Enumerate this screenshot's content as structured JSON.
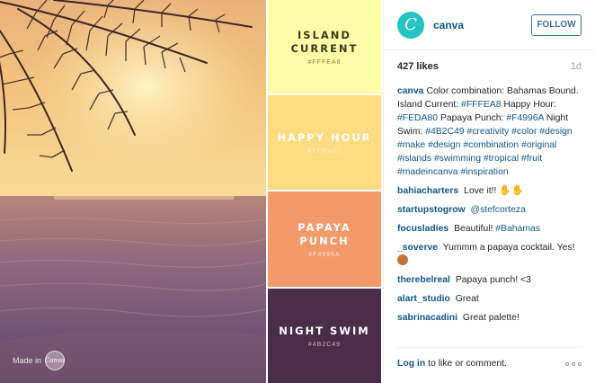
{
  "colors": {
    "island_current": "#FFFEA8",
    "happy_hour": "#FEDA80",
    "papaya_punch": "#F4996A",
    "night_swim": "#4B2C49",
    "link": "#125688",
    "follow_border": "#3f729b",
    "brand": "#23c4c1"
  },
  "photo": {
    "watermark_text": "Made in",
    "watermark_logo": "Canva"
  },
  "swatches": [
    {
      "name": "ISLAND CURRENT",
      "hex": "#FFFEA8"
    },
    {
      "name": "HAPPY HOUR",
      "hex": "#FEDA80"
    },
    {
      "name": "PAPAYA PUNCH",
      "hex": "#F4996A"
    },
    {
      "name": "NIGHT SWIM",
      "hex": "#4B2C49"
    }
  ],
  "header": {
    "avatar_letter": "C",
    "username": "canva",
    "follow_label": "FOLLOW"
  },
  "stats": {
    "likes": "427 likes",
    "time": "1d"
  },
  "caption": {
    "user": "canva",
    "segments": [
      {
        "text": "Color combination: Bahamas Bound. Island Current: ",
        "link": false
      },
      {
        "text": "#FFFEA8",
        "link": true
      },
      {
        "text": " Happy Hour: ",
        "link": false
      },
      {
        "text": "#FEDA80",
        "link": true
      },
      {
        "text": " Papaya Punch: ",
        "link": false
      },
      {
        "text": "#F4996A",
        "link": true
      },
      {
        "text": " Night Swim: ",
        "link": false
      },
      {
        "text": "#4B2C49",
        "link": true
      },
      {
        "text": " ",
        "link": false
      },
      {
        "text": "#creativity",
        "link": true
      },
      {
        "text": " ",
        "link": false
      },
      {
        "text": "#color",
        "link": true
      },
      {
        "text": " ",
        "link": false
      },
      {
        "text": "#design",
        "link": true
      },
      {
        "text": " ",
        "link": false
      },
      {
        "text": "#make",
        "link": true
      },
      {
        "text": " ",
        "link": false
      },
      {
        "text": "#design",
        "link": true
      },
      {
        "text": " ",
        "link": false
      },
      {
        "text": "#combination",
        "link": true
      },
      {
        "text": " ",
        "link": false
      },
      {
        "text": "#original",
        "link": true
      },
      {
        "text": " ",
        "link": false
      },
      {
        "text": "#islands",
        "link": true
      },
      {
        "text": " ",
        "link": false
      },
      {
        "text": "#swimming",
        "link": true
      },
      {
        "text": " ",
        "link": false
      },
      {
        "text": "#tropical",
        "link": true
      },
      {
        "text": " ",
        "link": false
      },
      {
        "text": "#fruit",
        "link": true
      },
      {
        "text": " ",
        "link": false
      },
      {
        "text": "#madeincanva",
        "link": true
      },
      {
        "text": " ",
        "link": false
      },
      {
        "text": "#inspiration",
        "link": true
      }
    ]
  },
  "comments": [
    {
      "user": "bahiacharters",
      "text": "Love it!!",
      "tag": "",
      "emoji": "hands"
    },
    {
      "user": "startupstogrow",
      "text": "",
      "tag": "@stefcorteza",
      "emoji": ""
    },
    {
      "user": "focusladies",
      "text": "Beautiful!",
      "tag": "#Bahamas",
      "emoji": ""
    },
    {
      "user": "_soverve",
      "text": "Yummm a papaya cocktail. Yes!",
      "tag": "",
      "emoji": "face"
    },
    {
      "user": "therebelreal",
      "text": "Papaya punch! <3",
      "tag": "",
      "emoji": ""
    },
    {
      "user": "alart_studio",
      "text": "Great",
      "tag": "",
      "emoji": ""
    },
    {
      "user": "sabrinacadini",
      "text": "Great palette!",
      "tag": "",
      "emoji": ""
    }
  ],
  "footer": {
    "login_label": "Log in",
    "rest_text": "to like or comment.",
    "more_icon": "ellipsis-icon"
  }
}
